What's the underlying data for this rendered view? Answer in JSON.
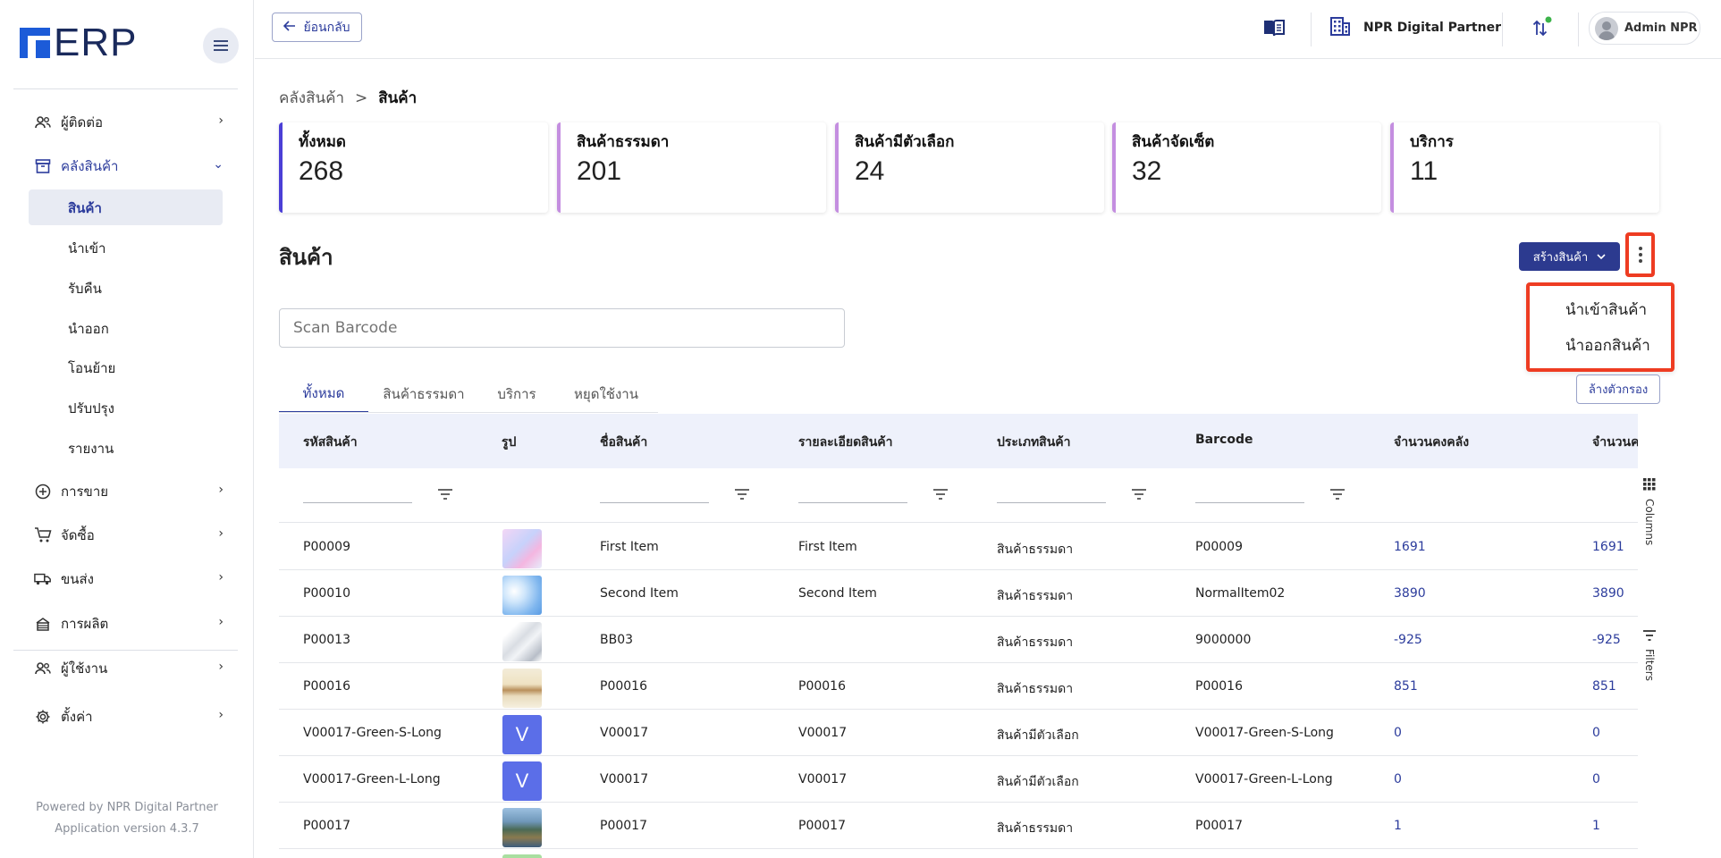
{
  "app": {
    "logo_text": "ERP"
  },
  "sidebar": {
    "items": [
      {
        "label": "ผู้ติดต่อ",
        "icon": "contacts-icon"
      },
      {
        "label": "คลังสินค้า",
        "icon": "warehouse-icon"
      },
      {
        "label": "การขาย",
        "icon": "plus-circle-icon"
      },
      {
        "label": "จัดซื้อ",
        "icon": "cart-icon"
      },
      {
        "label": "ขนส่ง",
        "icon": "truck-icon"
      },
      {
        "label": "การผลิต",
        "icon": "factory-icon"
      },
      {
        "label": "ผู้ใช้งาน",
        "icon": "users-icon"
      },
      {
        "label": "ตั้งค่า",
        "icon": "gear-icon"
      }
    ],
    "sub_items": [
      "สินค้า",
      "นำเข้า",
      "รับคืน",
      "นำออก",
      "โอนย้าย",
      "ปรับปรุง",
      "รายงาน"
    ],
    "footer": {
      "powered": "Powered by NPR Digital Partner",
      "version": "Application version 4.3.7"
    }
  },
  "topbar": {
    "back_label": "ย้อนกลับ",
    "company": "NPR Digital Partner",
    "user": "Admin NPR"
  },
  "breadcrumb": {
    "parent": "คลังสินค้า",
    "separator": ">",
    "current": "สินค้า"
  },
  "stats": [
    {
      "label": "ทั้งหมด",
      "value": "268",
      "color": "#4b3fd6"
    },
    {
      "label": "สินค้าธรรมดา",
      "value": "201",
      "color": "#c48ee0"
    },
    {
      "label": "สินค้ามีตัวเลือก",
      "value": "24",
      "color": "#c48ee0"
    },
    {
      "label": "สินค้าจัดเซ็ต",
      "value": "32",
      "color": "#c48ee0"
    },
    {
      "label": "บริการ",
      "value": "11",
      "color": "#c48ee0"
    }
  ],
  "page": {
    "title": "สินค้า",
    "create_label": "สร้างสินค้า",
    "menu": [
      "นำเข้าสินค้า",
      "นำออกสินค้า"
    ],
    "scan_placeholder": "Scan Barcode",
    "tabs": [
      "ทั้งหมด",
      "สินค้าธรรมดา",
      "บริการ",
      "หยุดใช้งาน"
    ],
    "clear_label": "ล้างตัวกรอง",
    "side_tools": [
      "Columns",
      "Filters"
    ]
  },
  "table": {
    "headers": [
      "รหัสสินค้า",
      "รูป",
      "ชื่อสินค้า",
      "รายละเอียดสินค้า",
      "ประเภทสินค้า",
      "Barcode",
      "จำนวนคงคลัง",
      "จำนวนค"
    ],
    "rows": [
      {
        "code": "P00009",
        "thumb": "pastel",
        "name": "First Item",
        "detail": "First Item",
        "type": "สินค้าธรรมดา",
        "barcode": "P00009",
        "stock": "1691",
        "qty": "1691"
      },
      {
        "code": "P00010",
        "thumb": "sky",
        "name": "Second Item",
        "detail": "Second Item",
        "type": "สินค้าธรรมดา",
        "barcode": "NormalItem02",
        "stock": "3890",
        "qty": "3890"
      },
      {
        "code": "P00013",
        "thumb": "roll",
        "name": "BB03",
        "detail": "",
        "type": "สินค้าธรรมดา",
        "barcode": "9000000",
        "stock": "-925",
        "qty": "-925"
      },
      {
        "code": "P00016",
        "thumb": "book",
        "name": "P00016",
        "detail": "P00016",
        "type": "สินค้าธรรมดา",
        "barcode": "P00016",
        "stock": "851",
        "qty": "851"
      },
      {
        "code": "V00017-Green-S-Long",
        "thumb": "V",
        "name": "V00017",
        "detail": "V00017",
        "type": "สินค้ามีตัวเลือก",
        "barcode": "V00017-Green-S-Long",
        "stock": "0",
        "qty": "0"
      },
      {
        "code": "V00017-Green-L-Long",
        "thumb": "V",
        "name": "V00017",
        "detail": "V00017",
        "type": "สินค้ามีตัวเลือก",
        "barcode": "V00017-Green-L-Long",
        "stock": "0",
        "qty": "0"
      },
      {
        "code": "P00017",
        "thumb": "duck",
        "name": "P00017",
        "detail": "P00017",
        "type": "สินค้าธรรมดา",
        "barcode": "P00017",
        "stock": "1",
        "qty": "1"
      }
    ]
  }
}
